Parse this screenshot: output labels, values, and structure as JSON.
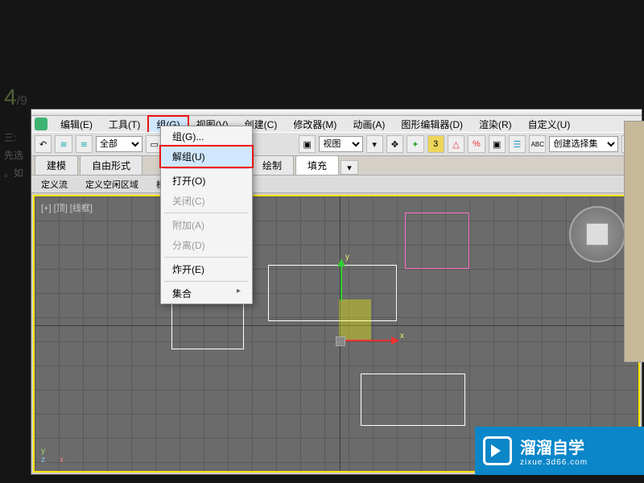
{
  "step": {
    "current": "4",
    "sep": "/9"
  },
  "side": {
    "line1": "三:",
    "line2": "先选",
    "line3": "。如"
  },
  "menubar": {
    "items": [
      {
        "label": "编辑(E)"
      },
      {
        "label": "工具(T)"
      },
      {
        "label": "组(G)"
      },
      {
        "label": "视图(V)"
      },
      {
        "label": "创建(C)"
      },
      {
        "label": "修改器(M)"
      },
      {
        "label": "动画(A)"
      },
      {
        "label": "图形编辑器(D)"
      },
      {
        "label": "渲染(R)"
      },
      {
        "label": "自定义(U)"
      }
    ]
  },
  "dropdown": {
    "group": "组(G)...",
    "ungroup": "解组(U)",
    "open": "打开(O)",
    "close": "关闭(C)",
    "attach": "附加(A)",
    "detach": "分离(D)",
    "explode": "炸开(E)",
    "assembly": "集合"
  },
  "toolbar": {
    "all_dropdown": "全部",
    "view_sel": "视图",
    "create_sel": "创建选择集"
  },
  "tabs": {
    "t1": "建模",
    "t2": "自由形式",
    "t3_partial": "绘制",
    "t4": "填充"
  },
  "subbar": {
    "s1": "定义流",
    "s2": "定义空闲区域",
    "s3": "模拟"
  },
  "viewport": {
    "label": "[+] [顶] [线框]",
    "axis_x": "x",
    "axis_y": "y",
    "corner_x": "x",
    "corner_y": "y",
    "corner_z": "z"
  },
  "watermark": {
    "title": "溜溜自学",
    "url": "zixue.3d66.com"
  }
}
